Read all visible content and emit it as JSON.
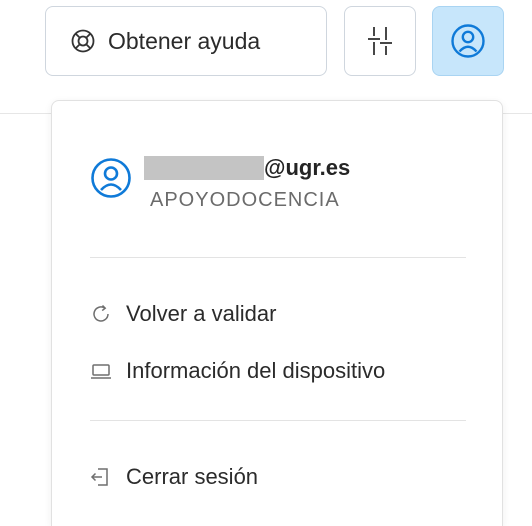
{
  "toolbar": {
    "help_label": "Obtener ayuda",
    "help_icon": "lifebuoy-icon",
    "filter_icon": "sliders-icon",
    "account_icon": "user-circle-icon",
    "account_active_color": "#c7e6fb",
    "accent_color": "#0f7ad8"
  },
  "account_menu": {
    "user": {
      "email_domain": "@ugr.es",
      "organization": "APOYODOCENCIA"
    },
    "items": [
      {
        "label": "Volver a validar",
        "icon": "refresh-icon"
      },
      {
        "label": "Información del dispositivo",
        "icon": "laptop-icon"
      }
    ],
    "signout": {
      "label": "Cerrar sesión",
      "icon": "sign-out-icon"
    }
  }
}
